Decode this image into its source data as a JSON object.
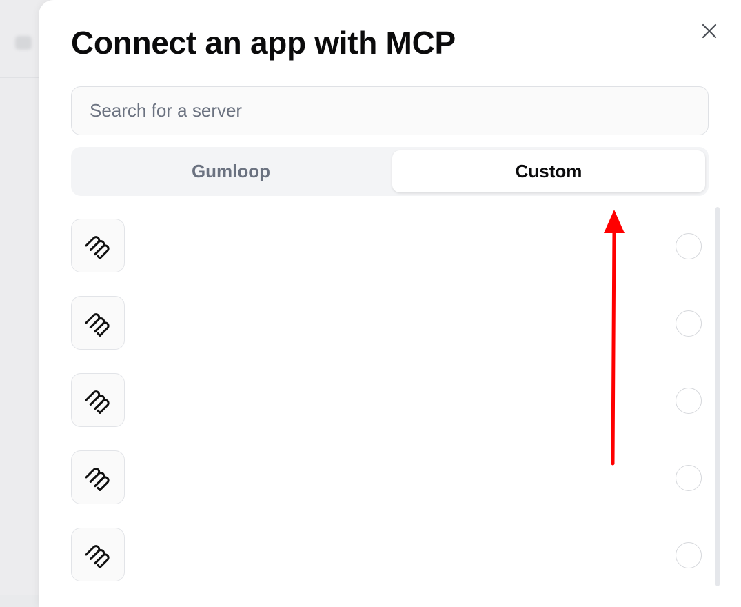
{
  "modal": {
    "title": "Connect an app with MCP",
    "close_icon": "close-icon"
  },
  "search": {
    "placeholder": "Search for a server",
    "value": ""
  },
  "tabs": [
    {
      "label": "Gumloop",
      "selected": false
    },
    {
      "label": "Custom",
      "selected": true
    }
  ],
  "servers": [
    {
      "icon": "gumloop-logo-icon",
      "name": "",
      "description": "",
      "selected": false
    },
    {
      "icon": "gumloop-logo-icon",
      "name": "",
      "description": "",
      "selected": false
    },
    {
      "icon": "gumloop-logo-icon",
      "name": "",
      "description": "",
      "selected": false
    },
    {
      "icon": "gumloop-logo-icon",
      "name": "",
      "description": "",
      "selected": false
    },
    {
      "icon": "gumloop-logo-icon",
      "name": "",
      "description": "",
      "selected": false
    }
  ],
  "annotation": {
    "arrow_color": "#ff0000",
    "arrow_icon": "up-arrow-annotation"
  },
  "colors": {
    "accent_text": "#0b0b0c",
    "muted_text": "#6b7280",
    "tab_track": "#f3f4f6"
  }
}
